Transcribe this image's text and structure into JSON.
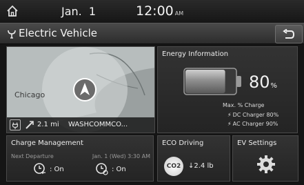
{
  "status_bar": {
    "date": "Jan.  1",
    "time": "12:00",
    "ampm": "AM"
  },
  "header": {
    "title": "Electric Vehicle"
  },
  "map": {
    "city_label": "Chicago",
    "distance": "2.1 mi",
    "destination": "WASHCOMMCO..."
  },
  "energy": {
    "title": "Energy Information",
    "battery_percent": "80",
    "percent_unit": "%",
    "battery_level": 0.8,
    "max_charge_label": "Max. % Charge",
    "dc_charger": "DC Charger 80%",
    "ac_charger": "AC Charger 90%"
  },
  "charge_management": {
    "title": "Charge Management",
    "next_departure_label": "Next Departure",
    "next_departure_value": "Jan. 1 (Wed) 3:30 AM",
    "charging_timer": ": On",
    "climate_timer": ": On"
  },
  "eco_driving": {
    "title": "ECO Driving",
    "badge": "CO2",
    "value": "2.4 lb"
  },
  "ev_settings": {
    "title": "EV Settings"
  },
  "colors": {
    "background": "#151515",
    "tile": "#2b2b2b",
    "battery_fill": "#8a8a8a",
    "text": "#e6e6e6"
  },
  "icons": [
    "home-icon",
    "ev-plug-icon",
    "back-icon",
    "map-plug-icon",
    "route-icon",
    "battery-icon",
    "bolt-icon",
    "charge-timer-icon",
    "climate-timer-icon",
    "co2-icon",
    "gear-icon"
  ]
}
